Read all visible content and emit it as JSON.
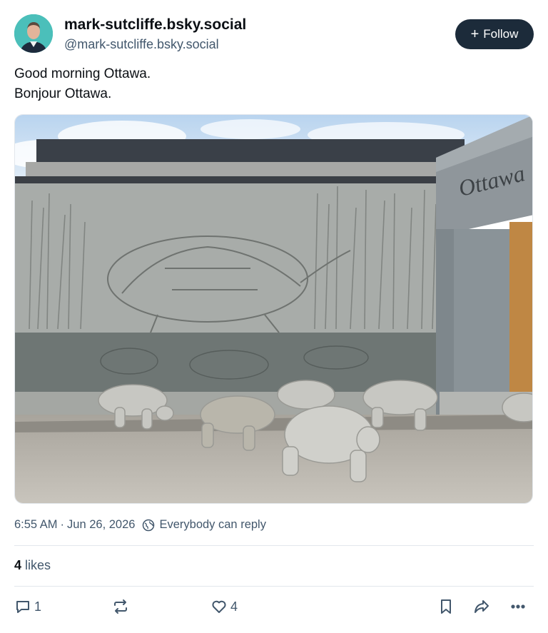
{
  "author": {
    "display_name": "mark-sutcliffe.bsky.social",
    "handle": "@mark-sutcliffe.bsky.social",
    "avatar_icon": "avatar"
  },
  "follow_button": {
    "label": "Follow",
    "icon": "plus-icon"
  },
  "post": {
    "lines": [
      "Good morning Ottawa.",
      "Bonjour Ottawa."
    ],
    "image": {
      "sign_text": "Ottawa",
      "description_icon": "photo-turtle-sculptures"
    }
  },
  "meta": {
    "time": "6:55 AM",
    "separator": "·",
    "date": "Jun 26, 2026",
    "reply_setting": "Everybody can reply"
  },
  "likes": {
    "count": "4",
    "label": "likes"
  },
  "actions": {
    "reply_count": "1",
    "repost_count": "",
    "like_count": "4"
  },
  "colors": {
    "primary_text": "#0b0f14",
    "secondary_text": "#42576c",
    "follow_bg": "#1c2b3a",
    "avatar_bg": "#1fb3a0",
    "divider": "#e2e7ec"
  }
}
